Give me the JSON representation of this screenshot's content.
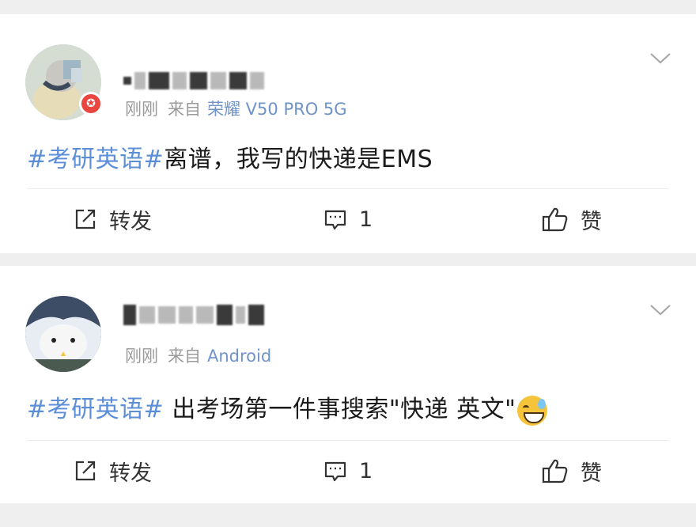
{
  "posts": [
    {
      "time": "刚刚",
      "from_label": "来自",
      "source": "荣耀 V50 PRO 5G",
      "hashtag": "#考研英语#",
      "text": "离谱，我写的快递是EMS",
      "actions": {
        "repost": "转发",
        "comment_count": "1",
        "like": "赞"
      }
    },
    {
      "time": "刚刚",
      "from_label": "来自",
      "source": "Android",
      "hashtag": "#考研英语#",
      "text": " 出考场第一件事搜索\"快递 英文\"",
      "actions": {
        "repost": "转发",
        "comment_count": "1",
        "like": "赞"
      }
    }
  ],
  "colors": {
    "hashtag": "#5b8ed6",
    "source": "#6f93c9",
    "meta": "#9a9a9a",
    "badge": "#e9463f"
  },
  "icons": [
    "chevron-down-icon",
    "repost-icon",
    "comment-icon",
    "like-icon",
    "verified-badge-icon",
    "grinning-sweat-emoji"
  ]
}
